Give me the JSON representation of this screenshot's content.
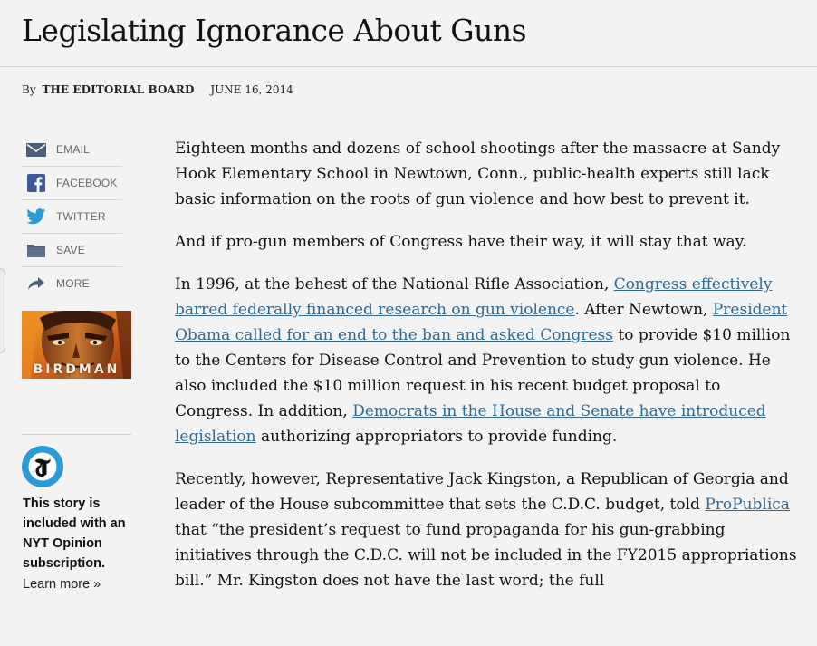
{
  "headline": "Legislating Ignorance About Guns",
  "byline": {
    "prefix": "By",
    "author": "THE EDITORIAL BOARD",
    "date": "JUNE 16, 2014"
  },
  "share": [
    {
      "label": "EMAIL",
      "icon": "envelope-icon"
    },
    {
      "label": "FACEBOOK",
      "icon": "facebook-icon"
    },
    {
      "label": "TWITTER",
      "icon": "twitter-bird-icon"
    },
    {
      "label": "SAVE",
      "icon": "folder-icon"
    },
    {
      "label": "MORE",
      "icon": "forward-arrow-icon"
    }
  ],
  "promo": {
    "image_caption": "BIRDMAN",
    "text": "This story is included with an NYT Opinion subscription.",
    "learn_more": "Learn more »"
  },
  "colors": {
    "background": "#f3f3f3",
    "link": "#326891",
    "share_icon": "#4d5f77",
    "twitter": "#2b9bd8",
    "facebook": "#3b5998"
  },
  "article": {
    "p1": "Eighteen months and dozens of school shootings after the massacre at Sandy Hook Elementary School in Newtown, Conn., public-health experts still lack basic information on the roots of gun violence and how best to prevent it.",
    "p2": "And if pro-gun members of Congress have their way, it will stay that way.",
    "p3": {
      "t1": "In 1996, at the behest of the National Rifle Association, ",
      "link1": "Congress effectively barred federally financed research on gun violence",
      "t2": ". After Newtown, ",
      "link2": "President Obama called for an end to the ban and asked Congress",
      "t3": " to provide $10 million to the Centers for Disease Control and Prevention to study gun violence. He also included the $10 million request in his recent budget proposal to Congress. In addition, ",
      "link3": "Democrats in the House and Senate have introduced legislation",
      "t4": " authorizing appropriators to provide funding."
    },
    "p4": {
      "t1": "Recently, however, Representative Jack Kingston, a Republican of Georgia and leader of the House subcommittee that sets the C.D.C. budget, told ",
      "link1": "ProPublica",
      "t2": " that “the president’s request to fund propaganda for his gun-grabbing initiatives through the C.D.C. will not be included in the FY2015 appropriations bill.” Mr. Kingston does not have the last word; the full"
    }
  }
}
